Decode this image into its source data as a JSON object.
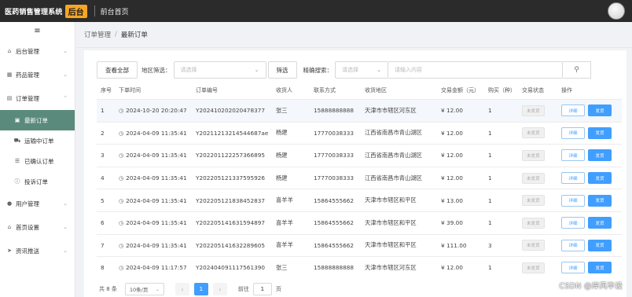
{
  "header": {
    "brand": "医药销售管理系统",
    "badge": "后台",
    "nav_home": "前台首页"
  },
  "sidebar": {
    "toggle": "≡",
    "groups": [
      {
        "label": "后台管理",
        "icon": "home-icon"
      },
      {
        "label": "药品管理",
        "icon": "grid-icon"
      },
      {
        "label": "订单管理",
        "icon": "cart-icon"
      }
    ],
    "order_items": [
      {
        "label": "最新订单",
        "icon": "document-icon",
        "active": true
      },
      {
        "label": "运输中订单",
        "icon": "truck-icon"
      },
      {
        "label": "已确认订单",
        "icon": "check-list-icon"
      },
      {
        "label": "投诉订单",
        "icon": "info-icon"
      }
    ],
    "groups_after": [
      {
        "label": "用户管理",
        "icon": "user-icon"
      },
      {
        "label": "首页设置",
        "icon": "home-icon"
      },
      {
        "label": "资讯推送",
        "icon": "send-icon"
      }
    ]
  },
  "breadcrumb": {
    "parent": "订单管理",
    "separator": "/",
    "current": "最新订单"
  },
  "filters": {
    "view_all": "查看全部",
    "region_label": "地区筛选：",
    "region_placeholder": "请选择",
    "filter_button": "筛选",
    "search_label": "精确搜索：",
    "search_type_placeholder": "请选择",
    "search_input_placeholder": "请输入内容"
  },
  "table": {
    "headers": [
      "序号",
      "下单时间",
      "订单编号",
      "收货人",
      "联系方式",
      "收货地区",
      "交易金额（元）",
      "购买（种）",
      "交易状态",
      "操作"
    ],
    "status_label": "未发货",
    "detail_label": "详细",
    "ship_label": "发货",
    "rows": [
      {
        "no": "1",
        "time": "2024-10-20 20:20:47",
        "order_id": "Y202410202020478377",
        "receiver": "张三",
        "phone": "15888888888",
        "region": "天津市市辖区河东区",
        "amount": "¥ 12.00",
        "kinds": "1"
      },
      {
        "no": "2",
        "time": "2024-04-09 11:35:41",
        "order_id": "Y20211213214544687ae",
        "receiver": "杨建",
        "phone": "17770038333",
        "region": "江西省南昌市青山湖区",
        "amount": "¥ 12.00",
        "kinds": "1"
      },
      {
        "no": "3",
        "time": "2024-04-09 11:35:41",
        "order_id": "Y202201122257366895",
        "receiver": "杨建",
        "phone": "17770038333",
        "region": "江西省南昌市青山湖区",
        "amount": "¥ 12.00",
        "kinds": "1"
      },
      {
        "no": "4",
        "time": "2024-04-09 11:35:41",
        "order_id": "Y202205121337595926",
        "receiver": "杨建",
        "phone": "17770038333",
        "region": "江西省南昌市青山湖区",
        "amount": "¥ 12.00",
        "kinds": "1"
      },
      {
        "no": "5",
        "time": "2024-04-09 11:35:41",
        "order_id": "Y202205121838452837",
        "receiver": "喜羊羊",
        "phone": "15864555662",
        "region": "天津市市辖区和平区",
        "amount": "¥ 13.00",
        "kinds": "1"
      },
      {
        "no": "6",
        "time": "2024-04-09 11:35:41",
        "order_id": "Y202205141631594897",
        "receiver": "喜羊羊",
        "phone": "15864555662",
        "region": "天津市市辖区和平区",
        "amount": "¥ 39.00",
        "kinds": "1"
      },
      {
        "no": "7",
        "time": "2024-04-09 11:35:41",
        "order_id": "Y202205141632289605",
        "receiver": "喜羊羊",
        "phone": "15864555662",
        "region": "天津市市辖区和平区",
        "amount": "¥ 111.00",
        "kinds": "3"
      },
      {
        "no": "8",
        "time": "2024-04-09 11:17:57",
        "order_id": "Y202404091117561390",
        "receiver": "张三",
        "phone": "15888888888",
        "region": "天津市市辖区河东区",
        "amount": "¥ 12.00",
        "kinds": "1"
      }
    ]
  },
  "pagination": {
    "total": "共 8 条",
    "page_size": "10条/页",
    "prev": "‹",
    "current": "1",
    "next": "›",
    "goto_label": "前往",
    "goto_value": "1",
    "goto_suffix": "页"
  },
  "watermark": "CSDN @岸风毕设"
}
